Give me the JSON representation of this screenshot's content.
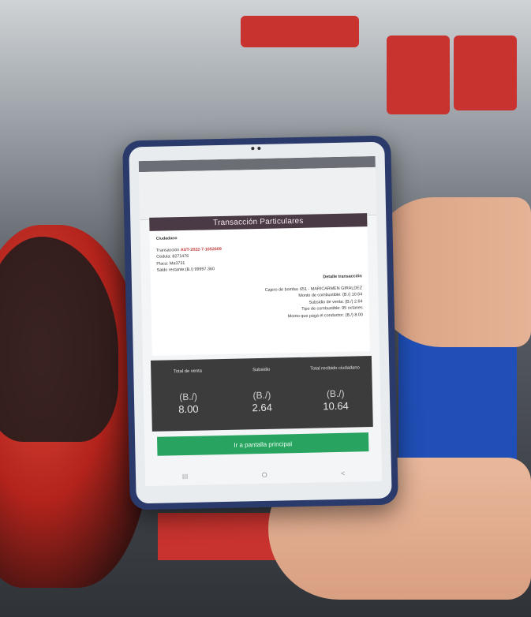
{
  "receipt": {
    "title": "Transacción Particulares",
    "section_label": "Ciudadano",
    "transaction_label": "Transacción",
    "transaction_id": "AUT-2022-7-1652609",
    "cedula": "Cedula: 8271476",
    "placa": "Placa: Ma3731",
    "saldo": "Saldo restante:(B./) 99997.360",
    "detail_title": "Detalle transacción",
    "cajero": "Cajero de bomba: 651 - MARICARMEN GIRALDEZ",
    "monto_combustible": "Monto de combustible: (B./) 10.64",
    "subsidio_venta": "Subsidio de venta: (B./) 2.64",
    "tipo_combustible": "Tipo de combustible: 95 octanes",
    "monto_conductor": "Monto que paga el conductor: (B./) 8.00"
  },
  "totals": [
    {
      "label": "Total de venta",
      "unit": "(B./)",
      "value": "8.00"
    },
    {
      "label": "Subsidio",
      "unit": "(B./)",
      "value": "2.64"
    },
    {
      "label": "Total recibido ciudadano",
      "unit": "(B./)",
      "value": "10.64"
    }
  ],
  "button": {
    "label": "Ir a pantalla principal"
  },
  "nav": {
    "recents": "III",
    "home": "O",
    "back": "<"
  },
  "colors": {
    "accent_green": "#28a460",
    "title_bar": "#4a3a46",
    "totals_bg": "#3c3c3c"
  }
}
